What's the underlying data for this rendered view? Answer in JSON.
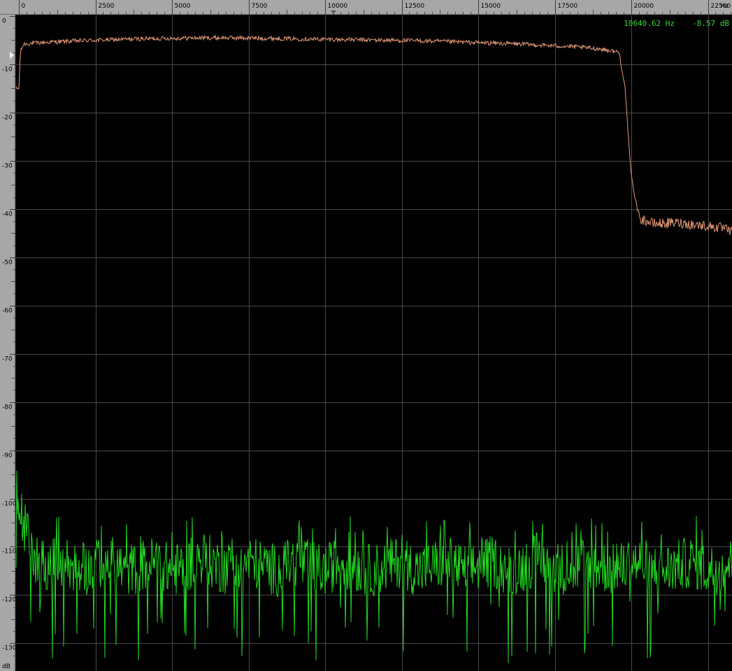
{
  "readout": {
    "frequency": "10640.62 Hz",
    "level": "-8.57 dB"
  },
  "colors": {
    "background": "#000000",
    "grid": "#4a4a4a",
    "axis_bg": "#a7a7a7",
    "upper_trace": "#e69a78",
    "lower_trace": "#22d822",
    "readout": "#3cd23c"
  },
  "chart_data": {
    "type": "line",
    "title": "",
    "x_unit_label": "Hz",
    "y_unit_label": "dB",
    "xlim": [
      0,
      24000
    ],
    "ylim": [
      -135,
      0
    ],
    "x_ticks": [
      0,
      2500,
      5000,
      7500,
      10000,
      12500,
      15000,
      17500,
      20000,
      22500
    ],
    "x_tick_labels": [
      "0",
      "2500",
      "5000",
      "7500",
      "10000",
      "12500",
      "15000",
      "17500",
      "20000",
      "22500"
    ],
    "y_ticks": [
      0,
      -10,
      -20,
      -30,
      -40,
      -50,
      -60,
      -70,
      -80,
      -90,
      -100,
      -110,
      -120,
      -130
    ],
    "y_tick_labels": [
      "0",
      "-10",
      "-20",
      "-30",
      "-40",
      "-50",
      "-60",
      "-70",
      "-80",
      "-90",
      "-100",
      "-110",
      "-120",
      "-130"
    ],
    "grid": true,
    "series": [
      {
        "color": "#e69a78",
        "x": [
          0,
          50,
          150,
          500,
          1000,
          2000,
          3000,
          4000,
          5000,
          6000,
          7000,
          8000,
          9000,
          10000,
          11000,
          12000,
          13000,
          14000,
          15000,
          16000,
          17000,
          18000,
          19000,
          19600,
          19800,
          19900,
          20000,
          20100,
          20200,
          20300,
          20500,
          20700,
          21000,
          21500,
          22000,
          22500,
          23000,
          23500,
          24000
        ],
        "y": [
          -15,
          -7.5,
          -5.8,
          -5.6,
          -5.4,
          -5.1,
          -4.9,
          -4.7,
          -4.6,
          -4.5,
          -4.5,
          -4.6,
          -4.7,
          -4.8,
          -4.9,
          -5.0,
          -5.1,
          -5.3,
          -5.5,
          -5.7,
          -6.0,
          -6.3,
          -6.8,
          -7.5,
          -15,
          -25,
          -33,
          -37,
          -40,
          -42,
          -42.5,
          -43,
          -43,
          -42.8,
          -43.2,
          -43.5,
          -44,
          -45.5,
          -42.5
        ]
      },
      {
        "color": "#22d822",
        "x": [
          0,
          500,
          1000,
          1500,
          2000,
          2500,
          3000,
          3500,
          4000,
          4500,
          5000,
          5500,
          6000,
          6500,
          7000,
          7500,
          8000,
          8500,
          9000,
          9500,
          10000,
          10500,
          11000,
          11500,
          12000,
          12500,
          13000,
          13500,
          14000,
          14500,
          15000,
          15500,
          16000,
          16500,
          17000,
          17500,
          18000,
          18500,
          19000,
          19500,
          20000,
          20500,
          21000,
          21500,
          22000,
          22500,
          23000,
          23500,
          24000
        ],
        "y": [
          -102,
          -112,
          -114,
          -113,
          -115,
          -114,
          -113,
          -115,
          -114,
          -113,
          -115,
          -114,
          -112,
          -114,
          -115,
          -113,
          -114,
          -115,
          -113,
          -114,
          -115,
          -113,
          -114,
          -115,
          -114,
          -113,
          -115,
          -114,
          -113,
          -115,
          -114,
          -113,
          -115,
          -114,
          -112,
          -114,
          -115,
          -113,
          -114,
          -115,
          -113,
          -114,
          -115,
          -114,
          -113,
          -115,
          -114,
          -113,
          -115
        ]
      }
    ]
  }
}
